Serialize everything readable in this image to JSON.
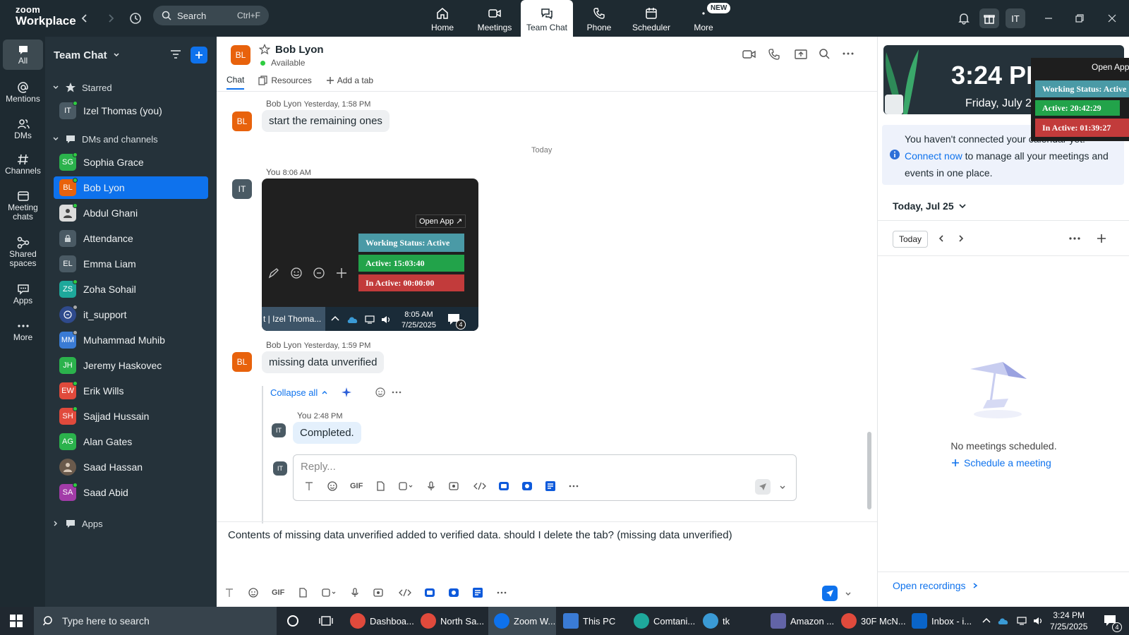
{
  "app": {
    "logo_line1": "zoom",
    "logo_line2": "Workplace"
  },
  "topbar": {
    "search_label": "Search",
    "search_shortcut": "Ctrl+F",
    "tabs": [
      {
        "label": "Home",
        "icon": "home-icon"
      },
      {
        "label": "Meetings",
        "icon": "video-icon"
      },
      {
        "label": "Team Chat",
        "icon": "chat-icon",
        "active": true
      },
      {
        "label": "Phone",
        "icon": "phone-icon"
      },
      {
        "label": "Scheduler",
        "icon": "calendar-icon"
      },
      {
        "label": "More",
        "icon": "more-icon",
        "badge": "NEW"
      }
    ],
    "user_initials": "IT"
  },
  "rail": {
    "items": [
      {
        "label": "All",
        "icon": "chat-bubble-icon",
        "active": true
      },
      {
        "label": "Mentions",
        "icon": "at-icon"
      },
      {
        "label": "DMs",
        "icon": "users-icon"
      },
      {
        "label": "Channels",
        "icon": "hash-icon"
      },
      {
        "label": "Meeting chats",
        "icon": "meeting-chat-icon"
      },
      {
        "label": "Shared spaces",
        "icon": "shared-icon"
      },
      {
        "label": "Apps",
        "icon": "apps-icon"
      },
      {
        "label": "More",
        "icon": "more-icon"
      }
    ]
  },
  "chatlist": {
    "title": "Team Chat",
    "sections": {
      "starred": "Starred",
      "dms": "DMs and channels",
      "apps": "Apps"
    },
    "starred": [
      {
        "initials": "IT",
        "name": "Izel Thomas (you)",
        "color": "#4a5a64"
      }
    ],
    "contacts": [
      {
        "initials": "SG",
        "name": "Sophia Grace",
        "color": "#2bb24c"
      },
      {
        "initials": "BL",
        "name": "Bob Lyon",
        "color": "#e8620c",
        "active": true
      },
      {
        "initials": "",
        "name": "Abdul Ghani",
        "color": "#dcdcdc"
      },
      {
        "initials": "",
        "name": "Attendance",
        "color": "#4a5a64"
      },
      {
        "initials": "EL",
        "name": "Emma Liam",
        "color": "#4a5a64"
      },
      {
        "initials": "ZS",
        "name": "Zoha Sohail",
        "color": "#1ea89b"
      },
      {
        "initials": "",
        "name": "it_support",
        "color": "#2f4a8c"
      },
      {
        "initials": "MM",
        "name": "Muhammad Muhib",
        "color": "#3a7bd5"
      },
      {
        "initials": "JH",
        "name": "Jeremy Haskovec",
        "color": "#2bb24c"
      },
      {
        "initials": "EW",
        "name": "Erik Wills",
        "color": "#e04a3c"
      },
      {
        "initials": "SH",
        "name": "Sajjad Hussain",
        "color": "#e04a3c"
      },
      {
        "initials": "AG",
        "name": "Alan Gates",
        "color": "#2bb24c"
      },
      {
        "initials": "",
        "name": "Saad Hassan",
        "color": "#6a5a4c"
      },
      {
        "initials": "SA",
        "name": "Saad Abid",
        "color": "#a23ca8"
      }
    ]
  },
  "chat": {
    "contact_initials": "BL",
    "contact_name": "Bob Lyon",
    "contact_status": "Available",
    "tabs": [
      "Chat",
      "Resources",
      "Add a tab"
    ],
    "messages": [
      {
        "sender": "Bob Lyon",
        "time": "Yesterday, 1:58 PM",
        "text": "start the remaining ones"
      },
      {
        "day_divider": "Today"
      },
      {
        "sender": "You",
        "time": "8:06 AM"
      },
      {
        "sender": "Bob Lyon",
        "time": "Yesterday, 1:59 PM",
        "text": "missing data unverified"
      }
    ],
    "screenshot": {
      "open_app": "Open App ↗",
      "working_status": "Working Status: Active",
      "active": "Active: 15:03:40",
      "inactive": "In Active: 00:00:00",
      "task_label": "t | Izel Thoma...",
      "time": "8:05 AM",
      "date": "7/25/2025",
      "notif_count": "4"
    },
    "thread": {
      "collapse_label": "Collapse all",
      "reply_sender": "You",
      "reply_time": "2:48 PM",
      "reply_text": "Completed.",
      "reply_placeholder": "Reply...",
      "user_initials": "IT"
    },
    "composer_text": "Contents of missing data unverified added to verified data. should I delete the tab? (missing data unverified)"
  },
  "right_panel": {
    "clock_time": "3:24 PM",
    "clock_date": "Friday, July 25",
    "floating": {
      "open_app": "Open App",
      "working_status": "Working Status: Active",
      "active": "Active: 20:42:29",
      "inactive": "In Active: 01:39:27"
    },
    "notice_before": "You haven't connected your calendar yet. ",
    "notice_link": "Connect now",
    "notice_after": " to manage all your meetings and events in one place.",
    "date_header": "Today, Jul 25",
    "today_button": "Today",
    "no_meetings": "No meetings scheduled.",
    "schedule_link": "Schedule a meeting",
    "recordings_link": "Open recordings"
  },
  "taskbar": {
    "search_placeholder": "Type here to search",
    "apps": [
      {
        "label": "Dashboa...",
        "color": "#e04a3c"
      },
      {
        "label": "North Sa...",
        "color": "#e04a3c"
      },
      {
        "label": "Zoom W...",
        "color": "#0e72ed",
        "active": true
      },
      {
        "label": "This PC",
        "color": "#3a7bd5"
      },
      {
        "label": "Comtani...",
        "color": "#1ea89b"
      },
      {
        "label": "tk",
        "color": "#3a9ad5"
      },
      {
        "label": "Amazon ...",
        "color": "#6264a7"
      },
      {
        "label": "30F McN...",
        "color": "#e04a3c"
      },
      {
        "label": "Inbox - i...",
        "color": "#0a64c8"
      }
    ],
    "time": "3:24 PM",
    "date": "7/25/2025",
    "notif_count": "4"
  }
}
